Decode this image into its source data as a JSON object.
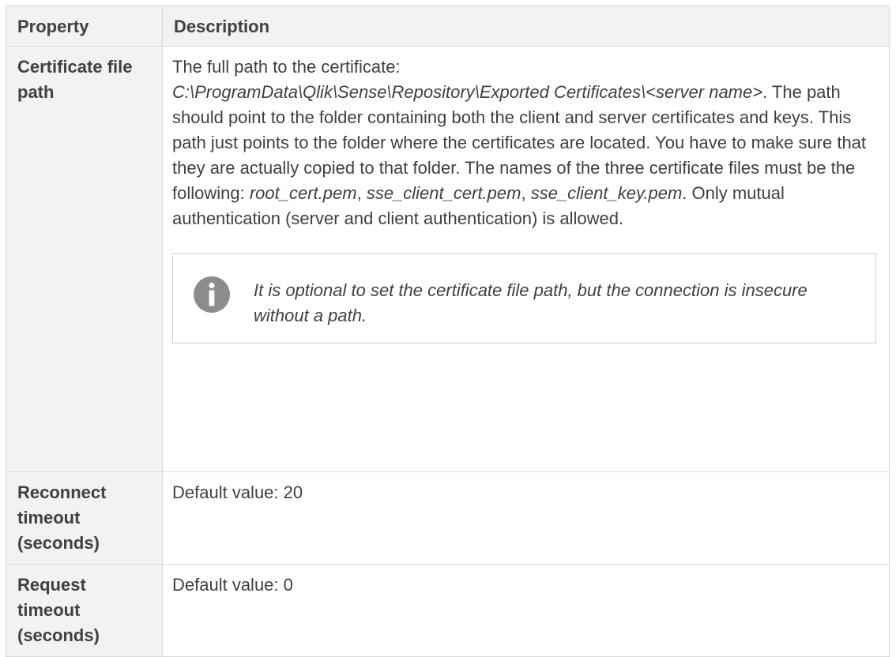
{
  "header": {
    "property": "Property",
    "description": "Description"
  },
  "rows": [
    {
      "property": "Certificate file path",
      "intro": "The full path to the certificate:",
      "path_italic": "C:\\ProgramData\\Qlik\\Sense\\Repository\\Exported Certificates\\<server name>",
      "after_path": ". The path should point to the folder containing both the client and server certificates and keys. This path just points to the folder where the certificates are located. You have to make sure that they are actually copied to that folder. The names of the three certificate files must be the following: ",
      "file1": "root_cert.pem",
      "sep1": ", ",
      "file2": "sse_client_cert.pem",
      "sep2": ", ",
      "file3": "sse_client_key.pem",
      "tail": ". Only mutual authentication (server and client authentication) is allowed.",
      "note": "It is optional to set the certificate file path, but the connection is insecure without a path.",
      "note_icon": "info-icon"
    },
    {
      "property": "Reconnect timeout (seconds)",
      "description": "Default value: 20"
    },
    {
      "property": "Request timeout (seconds)",
      "description": "Default value: 0"
    }
  ],
  "colors": {
    "header_bg": "#f2f2f2",
    "border": "#d9d9d9",
    "text": "#404040",
    "icon": "#8c8c8c"
  }
}
